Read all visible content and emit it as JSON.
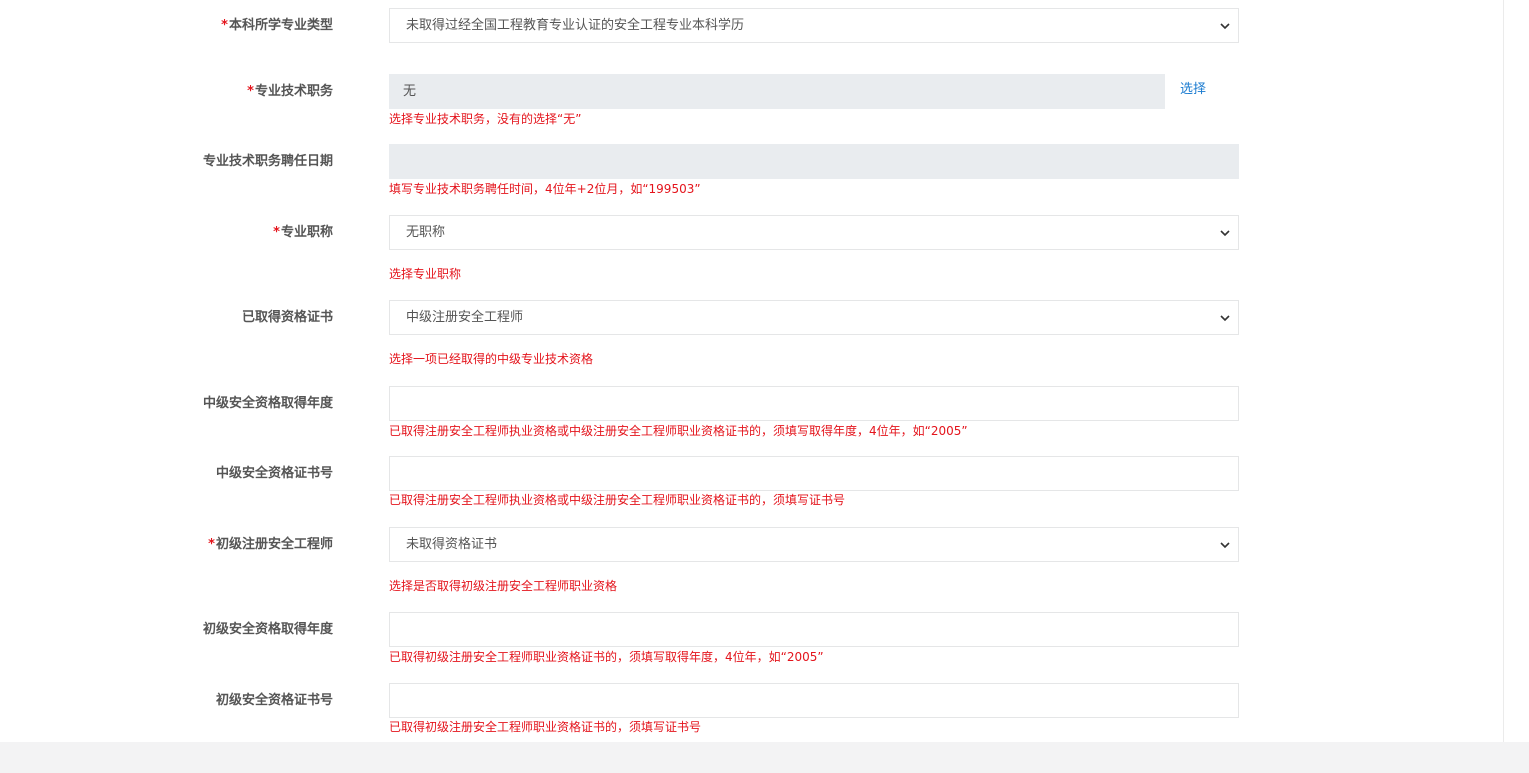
{
  "fields": [
    {
      "label": "本科所学专业类型",
      "required": true,
      "type": "select",
      "value": "未取得过经全国工程教育专业认证的安全工程专业本科学历",
      "hint": ""
    },
    {
      "label": "专业技术职务",
      "required": true,
      "type": "readonly",
      "value": "无",
      "hint": "选择专业技术职务，没有的选择“无”",
      "action": "选择"
    },
    {
      "label": "专业技术职务聘任日期",
      "required": false,
      "type": "readonly",
      "value": "",
      "hint": "填写专业技术职务聘任时间，4位年+2位月，如“199503”"
    },
    {
      "label": "专业职称",
      "required": true,
      "type": "select",
      "value": "无职称",
      "hint": "选择专业职称"
    },
    {
      "label": "已取得资格证书",
      "required": false,
      "type": "select",
      "value": "中级注册安全工程师",
      "hint": "选择一项已经取得的中级专业技术资格"
    },
    {
      "label": "中级安全资格取得年度",
      "required": false,
      "type": "text",
      "value": "",
      "hint": "已取得注册安全工程师执业资格或中级注册安全工程师职业资格证书的，须填写取得年度，4位年，如“2005”"
    },
    {
      "label": "中级安全资格证书号",
      "required": false,
      "type": "text",
      "value": "",
      "hint": "已取得注册安全工程师执业资格或中级注册安全工程师职业资格证书的，须填写证书号"
    },
    {
      "label": "初级注册安全工程师",
      "required": true,
      "type": "select",
      "value": "未取得资格证书",
      "hint": "选择是否取得初级注册安全工程师职业资格"
    },
    {
      "label": "初级安全资格取得年度",
      "required": false,
      "type": "text",
      "value": "",
      "hint": "已取得初级注册安全工程师职业资格证书的，须填写取得年度，4位年，如“2005”"
    },
    {
      "label": "初级安全资格证书号",
      "required": false,
      "type": "text",
      "value": "",
      "hint": "已取得初级注册安全工程师职业资格证书的，须填写证书号"
    }
  ],
  "required_mark": "*",
  "icons": {
    "select_arrow": "chevron-down-icon"
  },
  "colors": {
    "required": "#e4141c",
    "hint": "#e4141c",
    "link": "#1a7bd0",
    "readonly_bg": "#e9ecef",
    "border": "#e5e6e7",
    "label": "#555555"
  }
}
